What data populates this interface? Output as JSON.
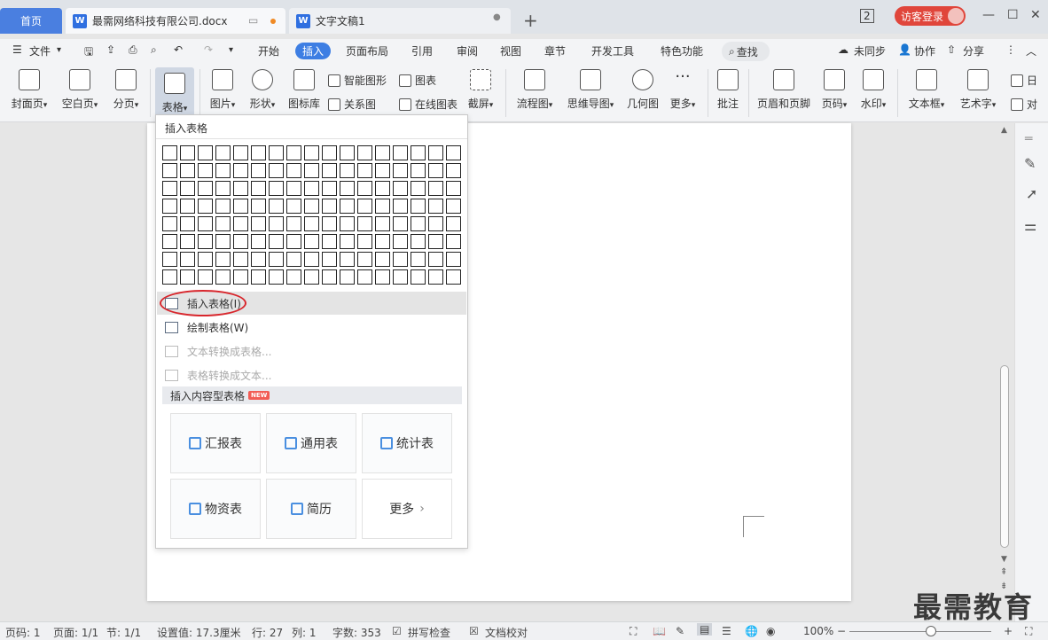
{
  "tabs": {
    "home": "首页",
    "active_doc": "最需网络科技有限公司.docx",
    "other_doc": "文字文稿1",
    "page_count_badge": "2",
    "visitor_login": "访客登录"
  },
  "menu": {
    "file": "文件",
    "items": [
      "开始",
      "插入",
      "页面布局",
      "引用",
      "审阅",
      "视图",
      "章节",
      "开发工具",
      "特色功能"
    ],
    "search": "查找",
    "sync": "未同步",
    "collab": "协作",
    "share": "分享"
  },
  "ribbon": {
    "cover": "封面页",
    "blank": "空白页",
    "pagebreak": "分页",
    "table": "表格",
    "picture": "图片",
    "shape": "形状",
    "icon_lib": "图标库",
    "smart_shape": "智能图形",
    "chart": "图表",
    "relation": "关系图",
    "online_chart": "在线图表",
    "screenshot": "截屏",
    "flowchart": "流程图",
    "mindmap": "思维导图",
    "geometry": "几何图",
    "more": "更多",
    "comment": "批注",
    "header_footer": "页眉和页脚",
    "page_number": "页码",
    "watermark": "水印",
    "textbox": "文本框",
    "wordart": "艺术字",
    "date_partial": "日",
    "object_partial": "对"
  },
  "dropdown": {
    "title": "插入表格",
    "insert_table": "插入表格(I)",
    "draw_table": "绘制表格(W)",
    "text_to_table": "文本转换成表格...",
    "table_to_text": "表格转换成文本...",
    "content_tables": "插入内容型表格",
    "new_badge": "NEW",
    "cards": [
      "汇报表",
      "通用表",
      "统计表",
      "物资表",
      "简历",
      "更多"
    ]
  },
  "status": {
    "page": "页码: 1",
    "pages": "页面: 1/1",
    "section": "节: 1/1",
    "setting": "设置值: 17.3厘米",
    "row": "行: 27",
    "col": "列: 1",
    "words": "字数: 353",
    "spell": "拼写检查",
    "proof": "文档校对",
    "zoom": "100%"
  },
  "watermark_text": "最需教育"
}
